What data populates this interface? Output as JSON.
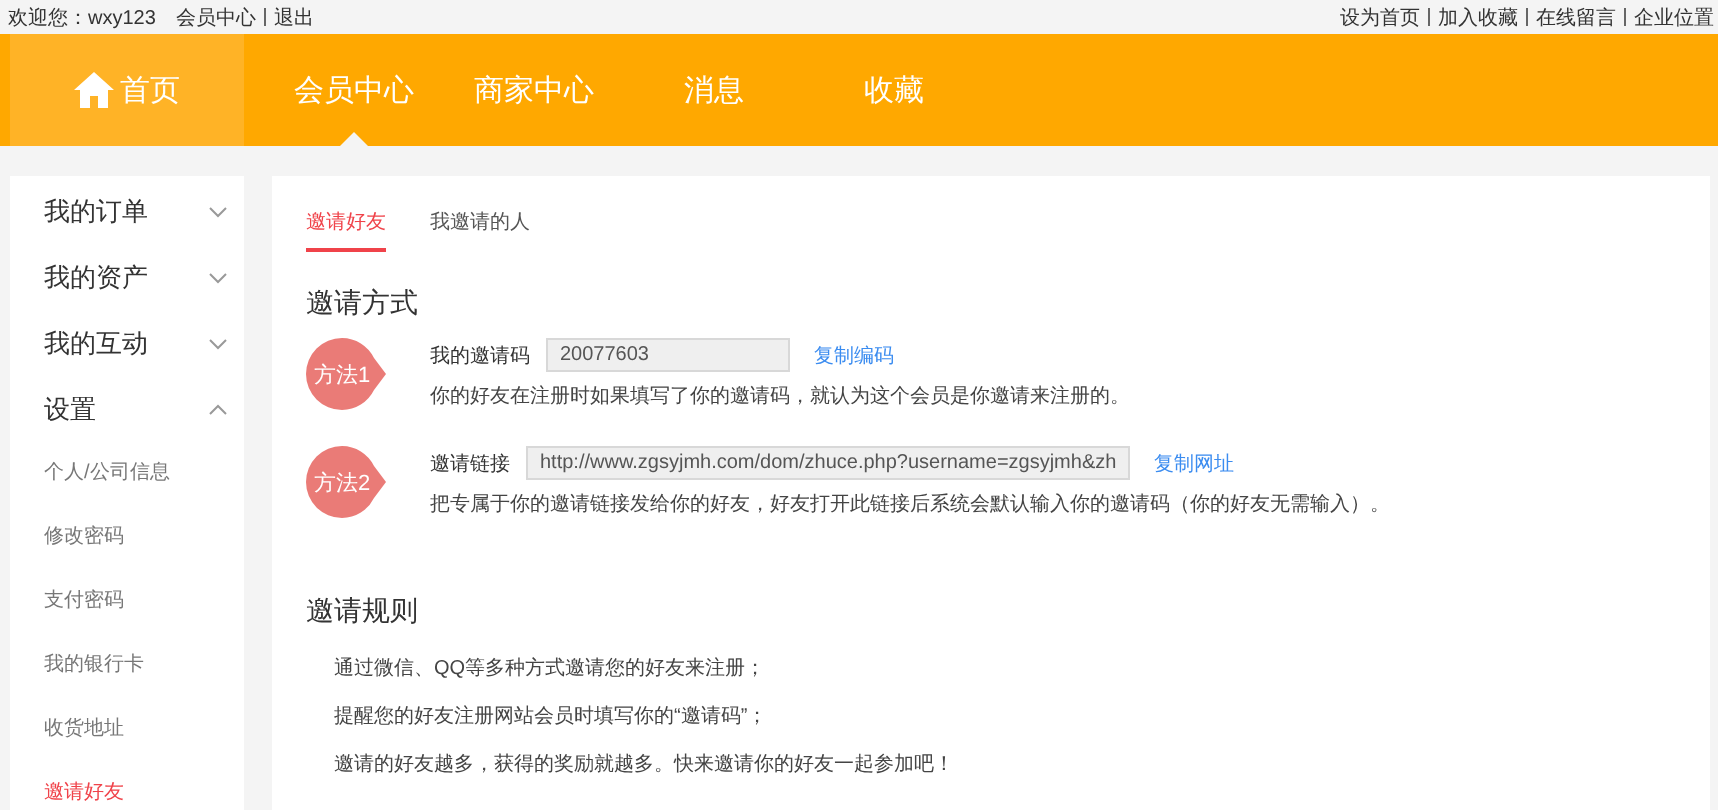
{
  "top_bar": {
    "greeting": "欢迎您：wxy123",
    "left_links": [
      "会员中心",
      "退出"
    ],
    "right_links": [
      "设为首页",
      "加入收藏",
      "在线留言",
      "企业位置"
    ]
  },
  "nav": [
    {
      "label": "首页",
      "kind": "home",
      "selected": false
    },
    {
      "label": "会员中心",
      "kind": "link",
      "selected": true
    },
    {
      "label": "商家中心",
      "kind": "link",
      "selected": false
    },
    {
      "label": "消息",
      "kind": "link",
      "selected": false
    },
    {
      "label": "收藏",
      "kind": "link",
      "selected": false
    }
  ],
  "sidebar": {
    "items": [
      {
        "label": "我的订单",
        "expanded": false
      },
      {
        "label": "我的资产",
        "expanded": false
      },
      {
        "label": "我的互动",
        "expanded": false
      },
      {
        "label": "设置",
        "expanded": true,
        "children": [
          {
            "label": "个人/公司信息",
            "selected": false
          },
          {
            "label": "修改密码",
            "selected": false
          },
          {
            "label": "支付密码",
            "selected": false
          },
          {
            "label": "我的银行卡",
            "selected": false
          },
          {
            "label": "收货地址",
            "selected": false
          },
          {
            "label": "邀请好友",
            "selected": true
          }
        ]
      }
    ]
  },
  "tabs": [
    {
      "label": "邀请好友",
      "selected": true
    },
    {
      "label": "我邀请的人",
      "selected": false
    }
  ],
  "methods_section": {
    "title": "邀请方式",
    "methods": [
      {
        "badge": "方法1",
        "label": "我的邀请码",
        "value": "20077603",
        "action": "复制编码",
        "description": "你的好友在注册时如果填写了你的邀请码，就认为这个会员是你邀请来注册的。"
      },
      {
        "badge": "方法2",
        "label": "邀请链接",
        "value": "http://www.zgsyjmh.com/dom/zhuce.php?username=zgsyjmh&zh",
        "action": "复制网址",
        "description": "把专属于你的邀请链接发给你的好友，好友打开此链接后系统会默认输入你的邀请码（你的好友无需输入）。"
      }
    ]
  },
  "rules_section": {
    "title": "邀请规则",
    "rules": [
      "通过微信、QQ等多种方式邀请您的好友来注册；",
      "提醒您的好友注册网站会员时填写你的“邀请码”；",
      "邀请的好友越多，获得的奖励就越多。快来邀请你的好友一起参加吧！"
    ]
  }
}
